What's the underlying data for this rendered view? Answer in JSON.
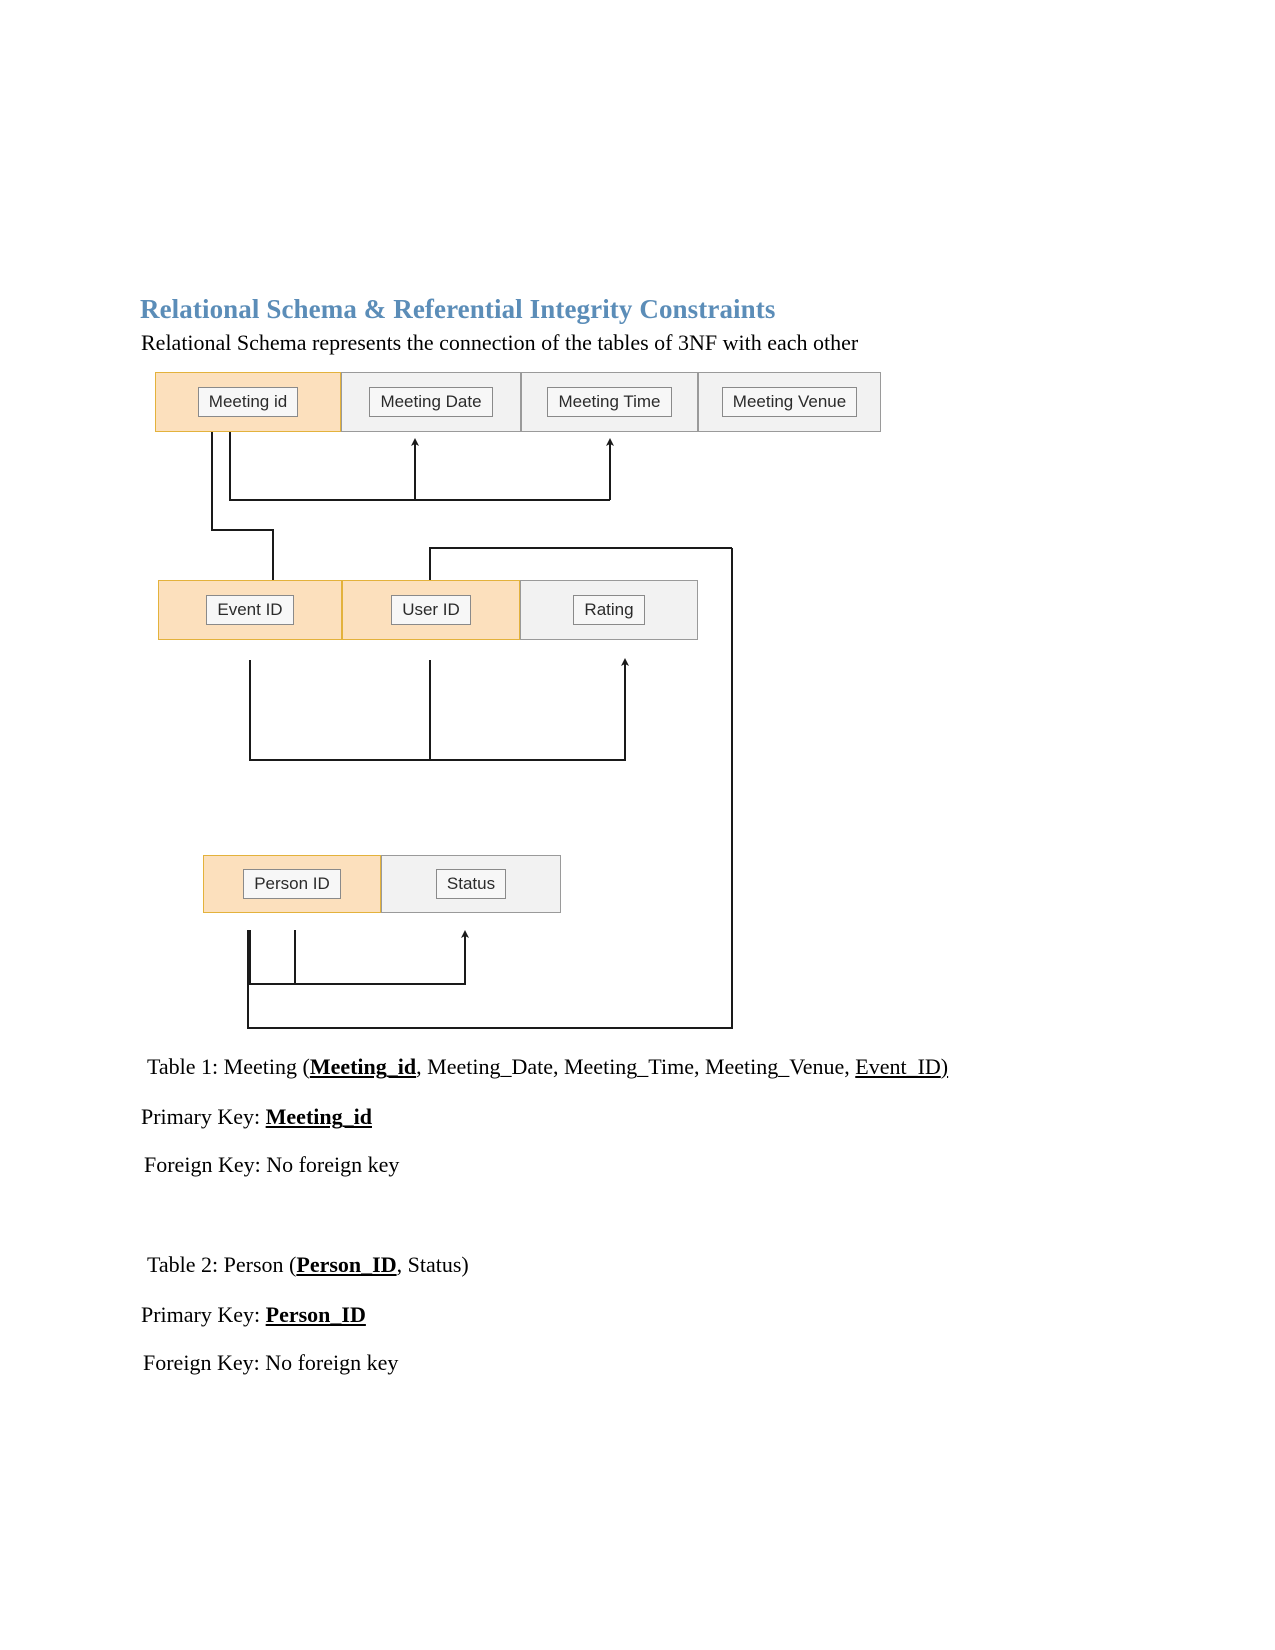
{
  "document": {
    "heading": "Relational Schema & Referential Integrity Constraints",
    "subtitle": "Relational Schema represents the connection of the tables of 3NF with each other"
  },
  "colors": {
    "heading_blue": "#5b8db8",
    "key_fill": "#fce0bd",
    "key_border": "#e3b23c",
    "plain_fill": "#f2f2f2",
    "plain_border": "#9a9a9a",
    "connector": "#1a1a1a",
    "text": "#000000"
  },
  "diagram": {
    "tables": [
      {
        "name": "meeting-relation",
        "cells": [
          {
            "label": "Meeting id",
            "key": true
          },
          {
            "label": "Meeting Date",
            "key": false
          },
          {
            "label": "Meeting Time",
            "key": false
          },
          {
            "label": "Meeting Venue",
            "key": false
          }
        ]
      },
      {
        "name": "rating-relation",
        "cells": [
          {
            "label": "Event ID",
            "key": true
          },
          {
            "label": "User ID",
            "key": true
          },
          {
            "label": "Rating",
            "key": false
          }
        ]
      },
      {
        "name": "person-relation",
        "cells": [
          {
            "label": "Person ID",
            "key": true
          },
          {
            "label": "Status",
            "key": false
          }
        ]
      }
    ]
  },
  "definitions": [
    {
      "name": "table-1",
      "title_prefix": "Table 1: Meeting (",
      "title_key": "Meeting_id",
      "title_middle": ", Meeting_Date, Meeting_Time, Meeting_Venue, ",
      "title_fk": "Event_ID",
      "title_suffix": ")",
      "primary_key_label": "Primary Key: ",
      "primary_key_value": "Meeting_id",
      "foreign_key_label": "Foreign Key: ",
      "foreign_key_value": "No foreign key"
    },
    {
      "name": "table-2",
      "title_prefix": "Table 2: Person (",
      "title_key": "Person_ID",
      "title_middle": ", Status",
      "title_fk": "",
      "title_suffix": ")",
      "primary_key_label": "Primary Key: ",
      "primary_key_value": "Person_ID",
      "foreign_key_label": "Foreign Key: ",
      "foreign_key_value": "No foreign key"
    }
  ]
}
